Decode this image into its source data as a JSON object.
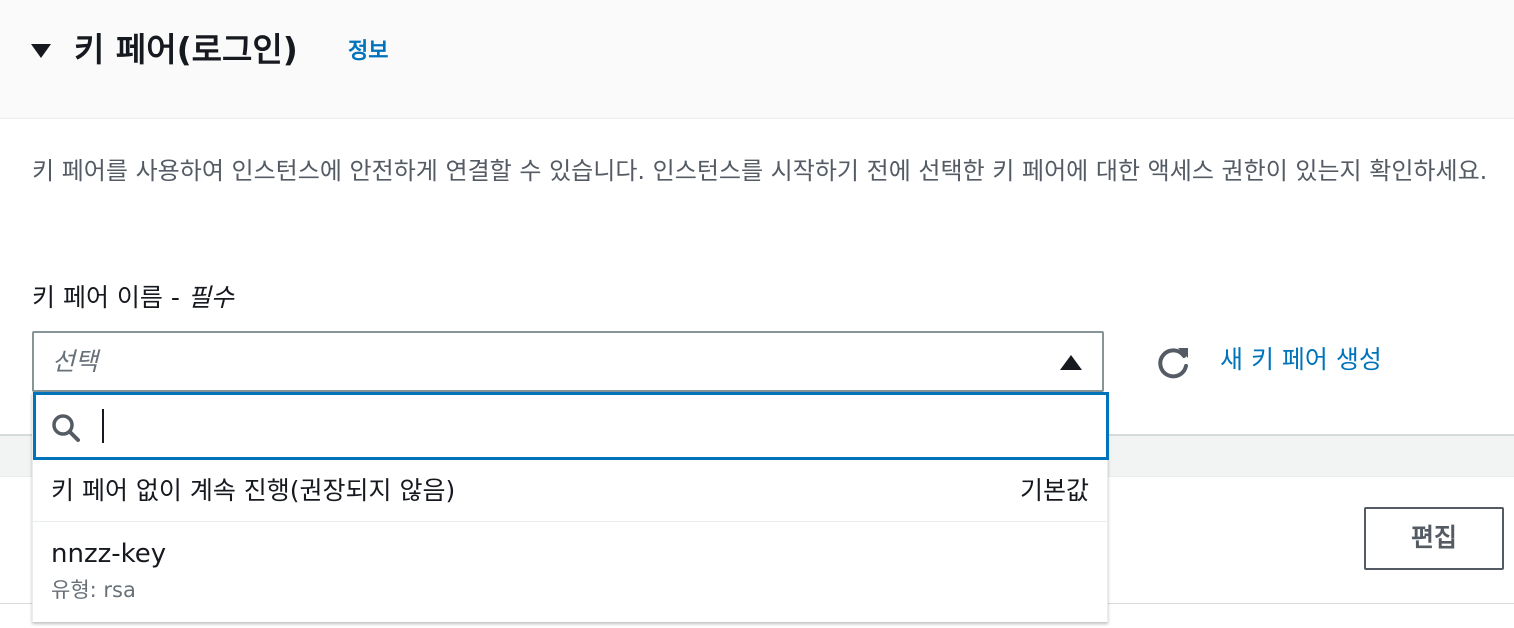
{
  "section": {
    "title": "키 페어(로그인)",
    "info_link": "정보",
    "description": "키 페어를 사용하여 인스턴스에 안전하게 연결할 수 있습니다. 인스턴스를 시작하기 전에 선택한 키 페어에 대한 액세스 권한이 있는지 확인하세요."
  },
  "field": {
    "label": "키 페어 이름 - ",
    "required_label": "필수",
    "placeholder": "선택",
    "search_value": ""
  },
  "actions": {
    "create_link": "새 키 페어 생성",
    "edit_button": "편집"
  },
  "dropdown": {
    "options": [
      {
        "label": "키 페어 없이 계속 진행(권장되지 않음)",
        "tag": "기본값"
      },
      {
        "label": "nnzz-key",
        "sublabel": "유형: rsa"
      }
    ]
  },
  "colors": {
    "link": "#0073bb",
    "focus_border": "#0073bb",
    "text": "#16191f",
    "muted": "#687078"
  },
  "icons": [
    "caret-down-icon",
    "caret-up-icon",
    "refresh-icon",
    "search-icon"
  ]
}
